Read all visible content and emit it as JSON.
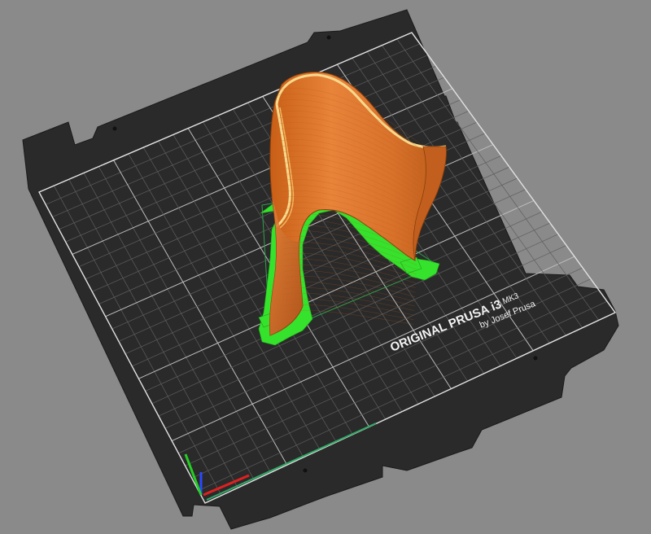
{
  "scene": {
    "background_color": "#8a8a8a",
    "bed": {
      "plate_color": "#2b2b2b",
      "grid_color": "#6f6f6f",
      "border_color": "#d8d8d8",
      "brand_line1": "ORIGINAL PRUSA i3",
      "brand_model": "MK3",
      "brand_line2": "by Josef Prusa"
    },
    "model": {
      "color": "#e07a2e",
      "support_color": "#33e02a",
      "highlight_color": "#f4d38a"
    },
    "axes": {
      "x_color": "#e02020",
      "y_color": "#20d020",
      "z_color": "#2040ff"
    }
  }
}
